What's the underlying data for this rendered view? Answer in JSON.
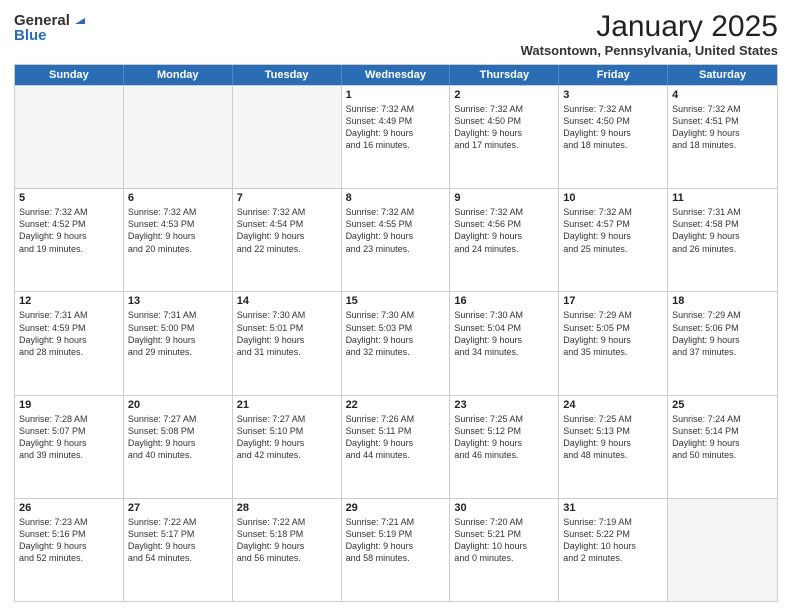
{
  "logo": {
    "general": "General",
    "blue": "Blue"
  },
  "header": {
    "month": "January 2025",
    "location": "Watsontown, Pennsylvania, United States"
  },
  "weekdays": [
    "Sunday",
    "Monday",
    "Tuesday",
    "Wednesday",
    "Thursday",
    "Friday",
    "Saturday"
  ],
  "rows": [
    [
      {
        "day": "",
        "info": ""
      },
      {
        "day": "",
        "info": ""
      },
      {
        "day": "",
        "info": ""
      },
      {
        "day": "1",
        "info": "Sunrise: 7:32 AM\nSunset: 4:49 PM\nDaylight: 9 hours\nand 16 minutes."
      },
      {
        "day": "2",
        "info": "Sunrise: 7:32 AM\nSunset: 4:50 PM\nDaylight: 9 hours\nand 17 minutes."
      },
      {
        "day": "3",
        "info": "Sunrise: 7:32 AM\nSunset: 4:50 PM\nDaylight: 9 hours\nand 18 minutes."
      },
      {
        "day": "4",
        "info": "Sunrise: 7:32 AM\nSunset: 4:51 PM\nDaylight: 9 hours\nand 18 minutes."
      }
    ],
    [
      {
        "day": "5",
        "info": "Sunrise: 7:32 AM\nSunset: 4:52 PM\nDaylight: 9 hours\nand 19 minutes."
      },
      {
        "day": "6",
        "info": "Sunrise: 7:32 AM\nSunset: 4:53 PM\nDaylight: 9 hours\nand 20 minutes."
      },
      {
        "day": "7",
        "info": "Sunrise: 7:32 AM\nSunset: 4:54 PM\nDaylight: 9 hours\nand 22 minutes."
      },
      {
        "day": "8",
        "info": "Sunrise: 7:32 AM\nSunset: 4:55 PM\nDaylight: 9 hours\nand 23 minutes."
      },
      {
        "day": "9",
        "info": "Sunrise: 7:32 AM\nSunset: 4:56 PM\nDaylight: 9 hours\nand 24 minutes."
      },
      {
        "day": "10",
        "info": "Sunrise: 7:32 AM\nSunset: 4:57 PM\nDaylight: 9 hours\nand 25 minutes."
      },
      {
        "day": "11",
        "info": "Sunrise: 7:31 AM\nSunset: 4:58 PM\nDaylight: 9 hours\nand 26 minutes."
      }
    ],
    [
      {
        "day": "12",
        "info": "Sunrise: 7:31 AM\nSunset: 4:59 PM\nDaylight: 9 hours\nand 28 minutes."
      },
      {
        "day": "13",
        "info": "Sunrise: 7:31 AM\nSunset: 5:00 PM\nDaylight: 9 hours\nand 29 minutes."
      },
      {
        "day": "14",
        "info": "Sunrise: 7:30 AM\nSunset: 5:01 PM\nDaylight: 9 hours\nand 31 minutes."
      },
      {
        "day": "15",
        "info": "Sunrise: 7:30 AM\nSunset: 5:03 PM\nDaylight: 9 hours\nand 32 minutes."
      },
      {
        "day": "16",
        "info": "Sunrise: 7:30 AM\nSunset: 5:04 PM\nDaylight: 9 hours\nand 34 minutes."
      },
      {
        "day": "17",
        "info": "Sunrise: 7:29 AM\nSunset: 5:05 PM\nDaylight: 9 hours\nand 35 minutes."
      },
      {
        "day": "18",
        "info": "Sunrise: 7:29 AM\nSunset: 5:06 PM\nDaylight: 9 hours\nand 37 minutes."
      }
    ],
    [
      {
        "day": "19",
        "info": "Sunrise: 7:28 AM\nSunset: 5:07 PM\nDaylight: 9 hours\nand 39 minutes."
      },
      {
        "day": "20",
        "info": "Sunrise: 7:27 AM\nSunset: 5:08 PM\nDaylight: 9 hours\nand 40 minutes."
      },
      {
        "day": "21",
        "info": "Sunrise: 7:27 AM\nSunset: 5:10 PM\nDaylight: 9 hours\nand 42 minutes."
      },
      {
        "day": "22",
        "info": "Sunrise: 7:26 AM\nSunset: 5:11 PM\nDaylight: 9 hours\nand 44 minutes."
      },
      {
        "day": "23",
        "info": "Sunrise: 7:25 AM\nSunset: 5:12 PM\nDaylight: 9 hours\nand 46 minutes."
      },
      {
        "day": "24",
        "info": "Sunrise: 7:25 AM\nSunset: 5:13 PM\nDaylight: 9 hours\nand 48 minutes."
      },
      {
        "day": "25",
        "info": "Sunrise: 7:24 AM\nSunset: 5:14 PM\nDaylight: 9 hours\nand 50 minutes."
      }
    ],
    [
      {
        "day": "26",
        "info": "Sunrise: 7:23 AM\nSunset: 5:16 PM\nDaylight: 9 hours\nand 52 minutes."
      },
      {
        "day": "27",
        "info": "Sunrise: 7:22 AM\nSunset: 5:17 PM\nDaylight: 9 hours\nand 54 minutes."
      },
      {
        "day": "28",
        "info": "Sunrise: 7:22 AM\nSunset: 5:18 PM\nDaylight: 9 hours\nand 56 minutes."
      },
      {
        "day": "29",
        "info": "Sunrise: 7:21 AM\nSunset: 5:19 PM\nDaylight: 9 hours\nand 58 minutes."
      },
      {
        "day": "30",
        "info": "Sunrise: 7:20 AM\nSunset: 5:21 PM\nDaylight: 10 hours\nand 0 minutes."
      },
      {
        "day": "31",
        "info": "Sunrise: 7:19 AM\nSunset: 5:22 PM\nDaylight: 10 hours\nand 2 minutes."
      },
      {
        "day": "",
        "info": ""
      }
    ]
  ]
}
